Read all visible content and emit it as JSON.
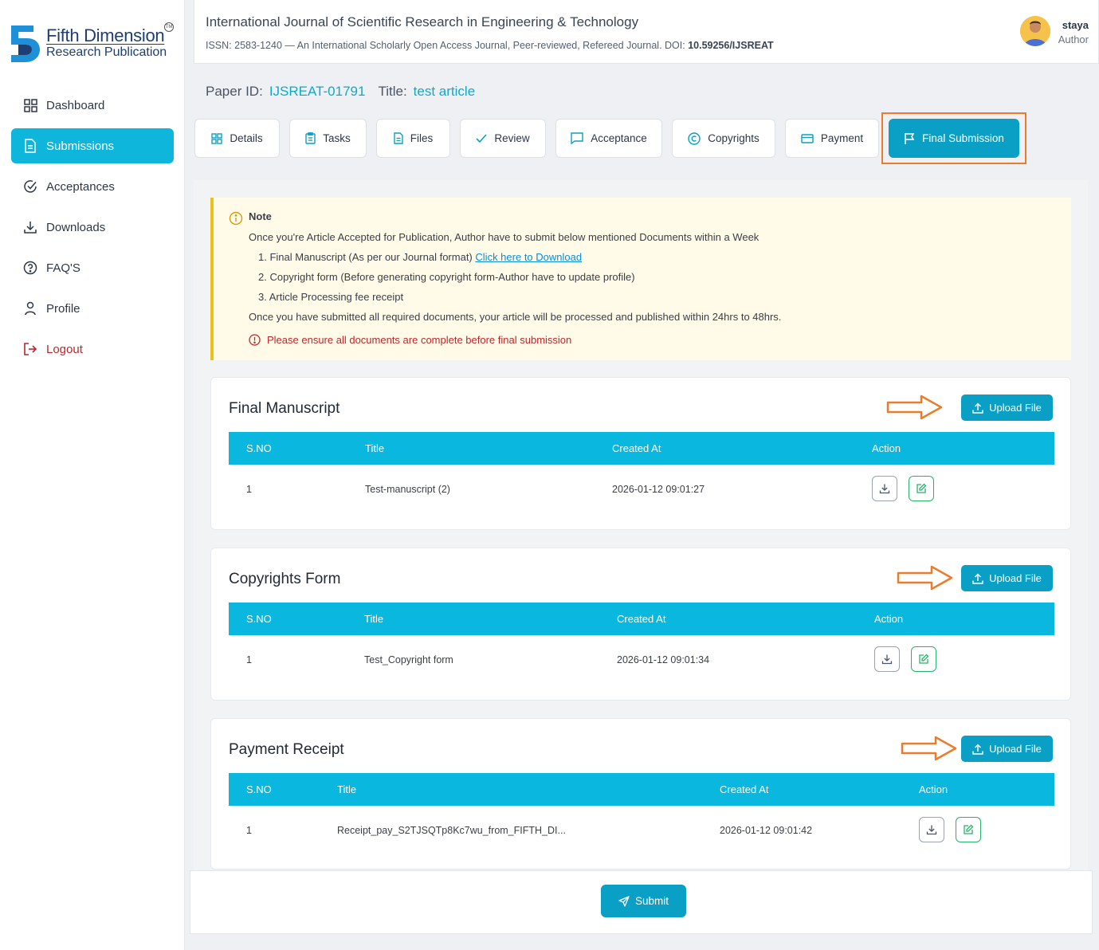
{
  "brand": {
    "name_line1": "Fifth Dimension",
    "name_line2": "Research Publication",
    "tm": "TM"
  },
  "sidebar": {
    "items": [
      {
        "label": "Dashboard",
        "icon": "grid-icon"
      },
      {
        "label": "Submissions",
        "icon": "document-icon",
        "active": true
      },
      {
        "label": "Acceptances",
        "icon": "check-circle-icon"
      },
      {
        "label": "Downloads",
        "icon": "download-icon"
      },
      {
        "label": "FAQ'S",
        "icon": "question-circle-icon"
      },
      {
        "label": "Profile",
        "icon": "user-icon"
      },
      {
        "label": "Logout",
        "icon": "logout-icon"
      }
    ]
  },
  "header": {
    "journal_title": "International Journal of Scientific Research in Engineering & Technology",
    "journal_sub": "ISSN: 2583-1240 — An International Scholarly Open Access Journal, Peer-reviewed, Refereed Journal. DOI:",
    "doi": "10.59256/IJSREAT",
    "user_name": "staya",
    "user_role": "Author"
  },
  "paper": {
    "id_label": "Paper ID:",
    "id_value": "IJSREAT-01791",
    "title_label": "Title:",
    "title_value": "test article"
  },
  "tabs": [
    {
      "label": "Details",
      "icon": "grid-icon"
    },
    {
      "label": "Tasks",
      "icon": "clipboard-icon"
    },
    {
      "label": "Files",
      "icon": "file-icon"
    },
    {
      "label": "Review",
      "icon": "check-icon"
    },
    {
      "label": "Acceptance",
      "icon": "message-icon"
    },
    {
      "label": "Copyrights",
      "icon": "copyright-icon"
    },
    {
      "label": "Payment",
      "icon": "credit-card-icon"
    },
    {
      "label": "Final Submission",
      "icon": "flag-icon",
      "active": true
    }
  ],
  "note": {
    "title": "Note",
    "intro": "Once you're Article Accepted for Publication, Author have to submit below mentioned Documents within a Week",
    "item1": "1. Final Manuscript (As per our Journal format)",
    "item1_link": "Click here to Download",
    "item2": "2. Copyright form (Before generating copyright form-Author have to update profile)",
    "item3": "3. Article Processing fee receipt",
    "outro": "Once you have submitted all required documents, your article will be processed and published within 24hrs to 48hrs.",
    "warning": "Please ensure all documents are complete before final submission"
  },
  "table_headers": {
    "sno": "S.NO",
    "title": "Title",
    "created": "Created At",
    "action": "Action"
  },
  "sections": [
    {
      "title": "Final Manuscript",
      "upload_label": "Upload File",
      "rows": [
        {
          "sno": "1",
          "title": "Test-manuscript (2)",
          "created": "2026-01-12 09:01:27"
        }
      ]
    },
    {
      "title": "Copyrights Form",
      "upload_label": "Upload File",
      "rows": [
        {
          "sno": "1",
          "title": "Test_Copyright form",
          "created": "2026-01-12 09:01:34"
        }
      ]
    },
    {
      "title": "Payment Receipt",
      "upload_label": "Upload File",
      "rows": [
        {
          "sno": "1",
          "title": "Receipt_pay_S2TJSQTp8Kc7wu_from_FIFTH_DI...",
          "created": "2026-01-12 09:01:42"
        }
      ]
    }
  ],
  "submit_label": "Submit",
  "colors": {
    "accent": "#0a9fc4",
    "table_header": "#0ab7df",
    "highlight": "#ea7c2c",
    "note_bg": "#fffbe8",
    "danger": "#c0262d"
  }
}
